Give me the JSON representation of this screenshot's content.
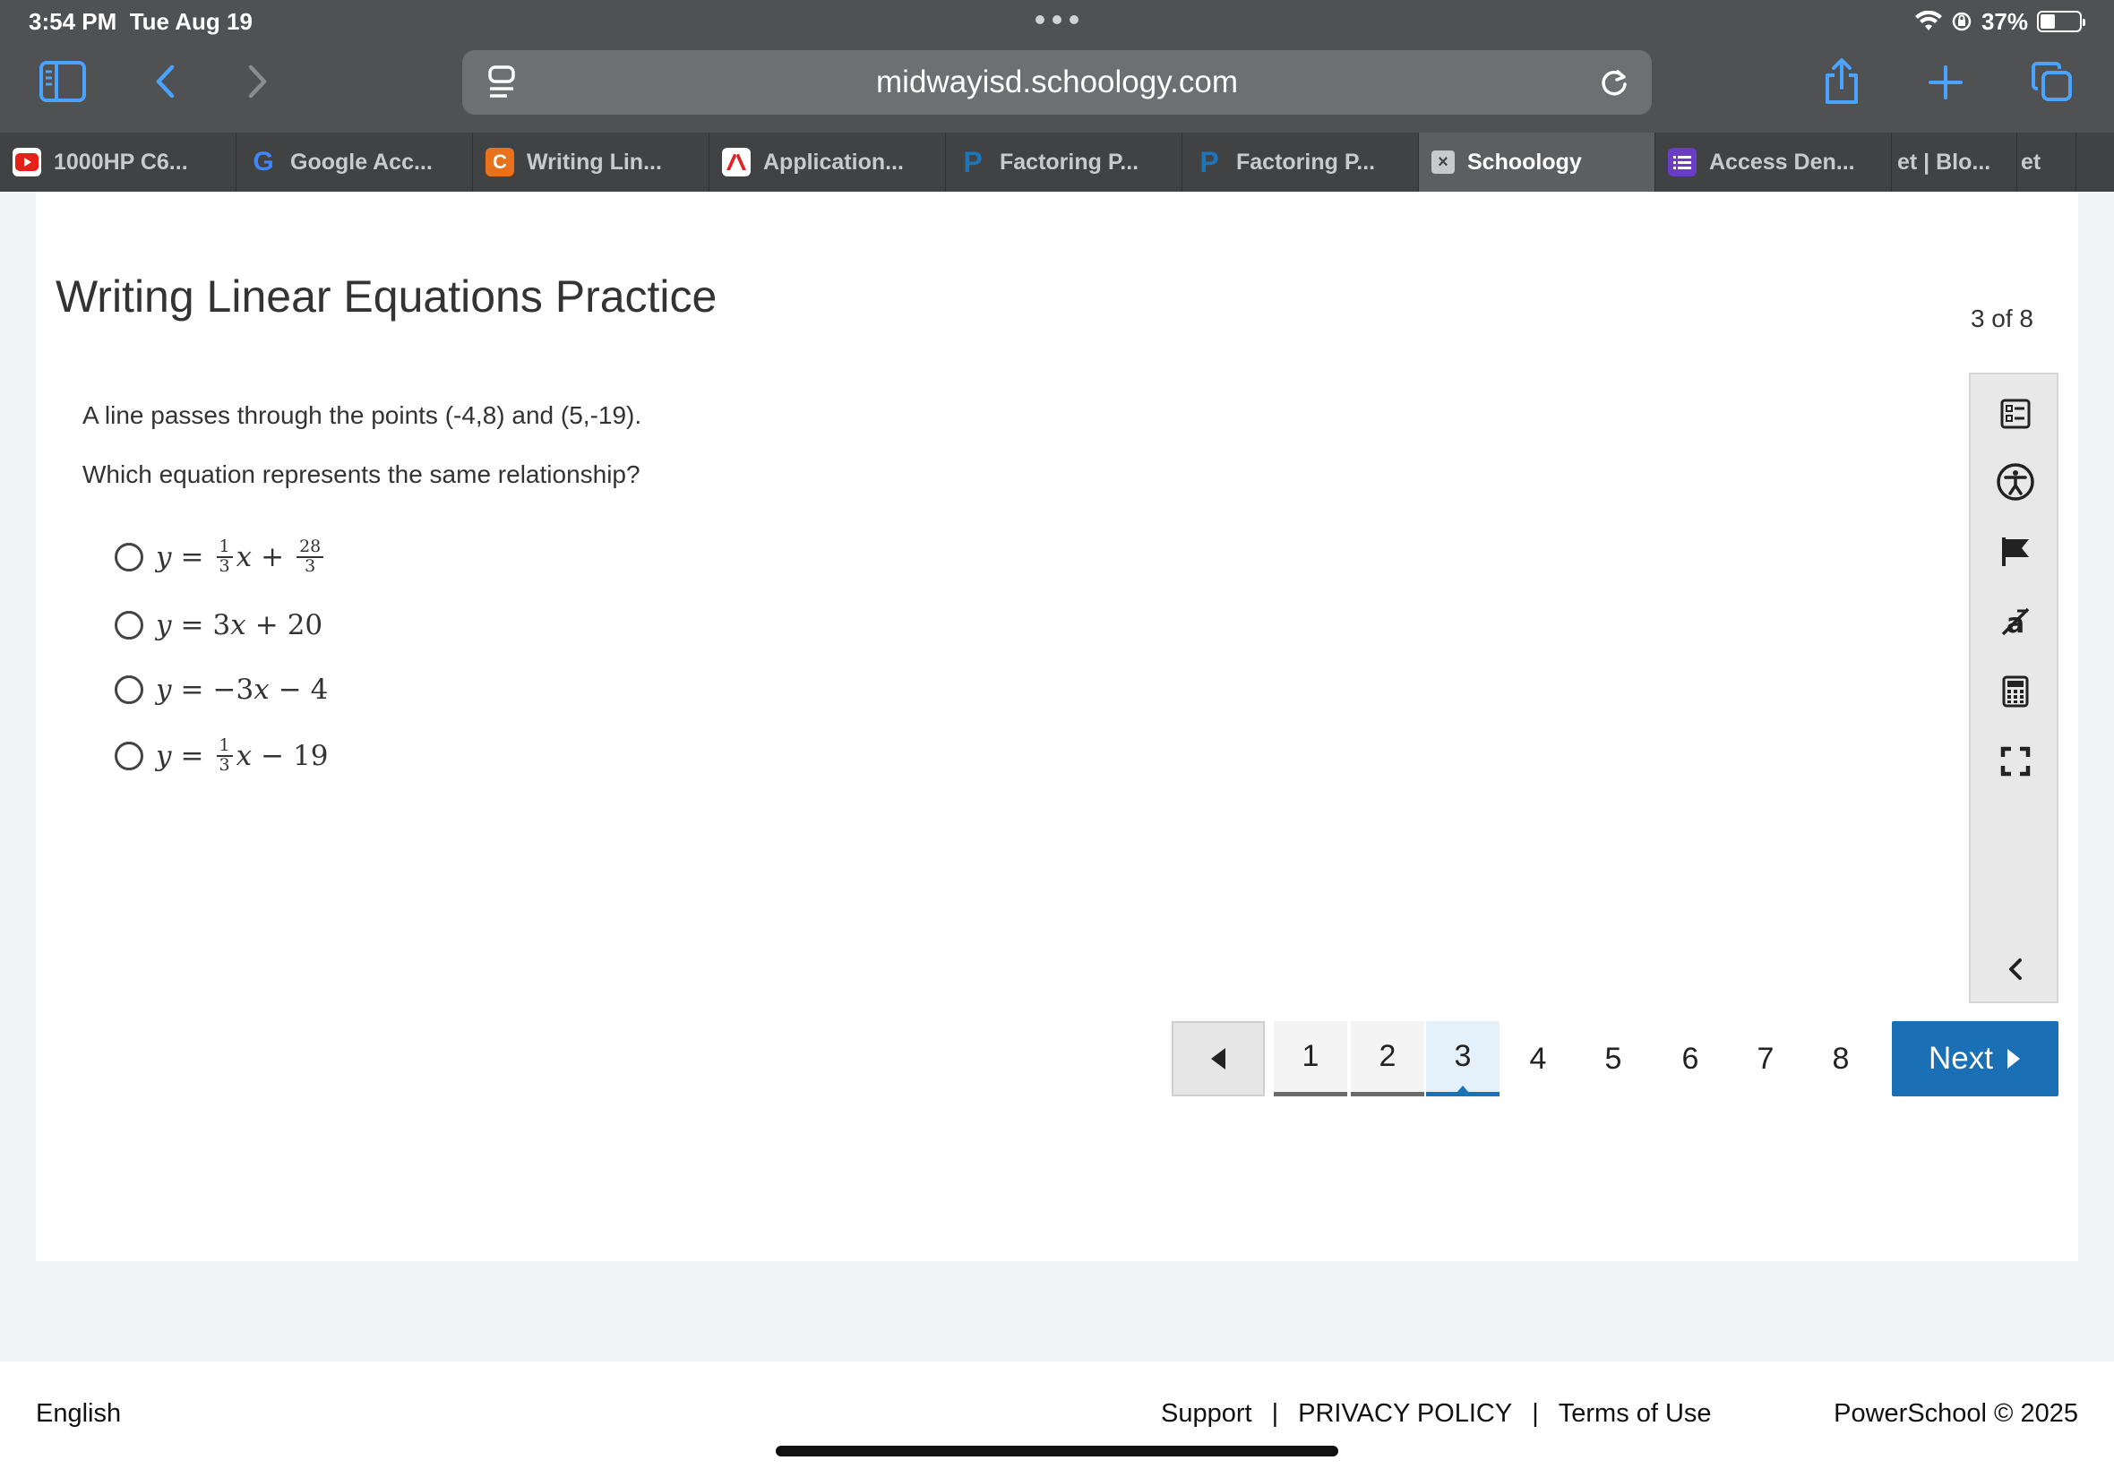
{
  "status_bar": {
    "time": "3:54 PM",
    "date": "Tue Aug 19",
    "battery": "37%",
    "battery_level": 0.37
  },
  "browser": {
    "url": "midwayisd.schoology.com",
    "tabs": [
      {
        "label": "1000HP C6...",
        "icon": "youtube-icon",
        "color": "#e62117",
        "active": false
      },
      {
        "label": "Google Acc...",
        "icon": "google-icon",
        "color": "#4285f4",
        "active": false
      },
      {
        "label": "Writing Lin...",
        "icon": "c-icon",
        "color": "#e8711b",
        "active": false
      },
      {
        "label": "Application...",
        "icon": "adobe-icon",
        "color": "#e22222",
        "active": false
      },
      {
        "label": "Factoring P...",
        "icon": "p-icon",
        "color": "#1c74b9",
        "active": false
      },
      {
        "label": "Factoring P...",
        "icon": "p-icon",
        "color": "#1c74b9",
        "active": false
      },
      {
        "label": "Schoology",
        "icon": "close-tab-icon",
        "color": "#d0d0d0",
        "active": true
      },
      {
        "label": "Access Den...",
        "icon": "list-icon",
        "color": "#6a3cc7",
        "active": false
      },
      {
        "label": "et | Blo...",
        "icon": "",
        "color": "",
        "active": false
      },
      {
        "label": "et",
        "icon": "",
        "color": "",
        "active": false
      }
    ]
  },
  "assessment": {
    "title": "Writing Linear Equations Practice",
    "progress": "3 of 8",
    "question_line1": "A line passes through the points (-4,8) and (5,-19).",
    "question_line2": "Which equation represents the same relationship?",
    "choices": [
      {
        "y": "y",
        "eq": "=",
        "frac1_num": "1",
        "frac1_den": "3",
        "x": "x",
        "op": "+",
        "frac2_num": "28",
        "frac2_den": "3"
      },
      {
        "y": "y",
        "eq": "=",
        "coef": "3",
        "x": "x",
        "op": "+",
        "const": "20"
      },
      {
        "y": "y",
        "eq": "=",
        "coef": "−3",
        "x": "x",
        "op": "−",
        "const": "4"
      },
      {
        "y": "y",
        "eq": "=",
        "frac1_num": "1",
        "frac1_den": "3",
        "x": "x",
        "op": "−",
        "const": "19"
      }
    ]
  },
  "pagination": {
    "pages": [
      "1",
      "2",
      "3",
      "4",
      "5",
      "6",
      "7",
      "8"
    ],
    "current": "3",
    "next_label": "Next"
  },
  "footer": {
    "language": "English",
    "support": "Support",
    "separator": "|",
    "privacy": "PRIVACY POLICY",
    "terms": "Terms of Use",
    "copyright": "PowerSchool © 2025"
  },
  "colors": {
    "accent": "#1a6fb5",
    "chrome_bg": "#4f5153",
    "safari_blue": "#4aa3ff"
  }
}
